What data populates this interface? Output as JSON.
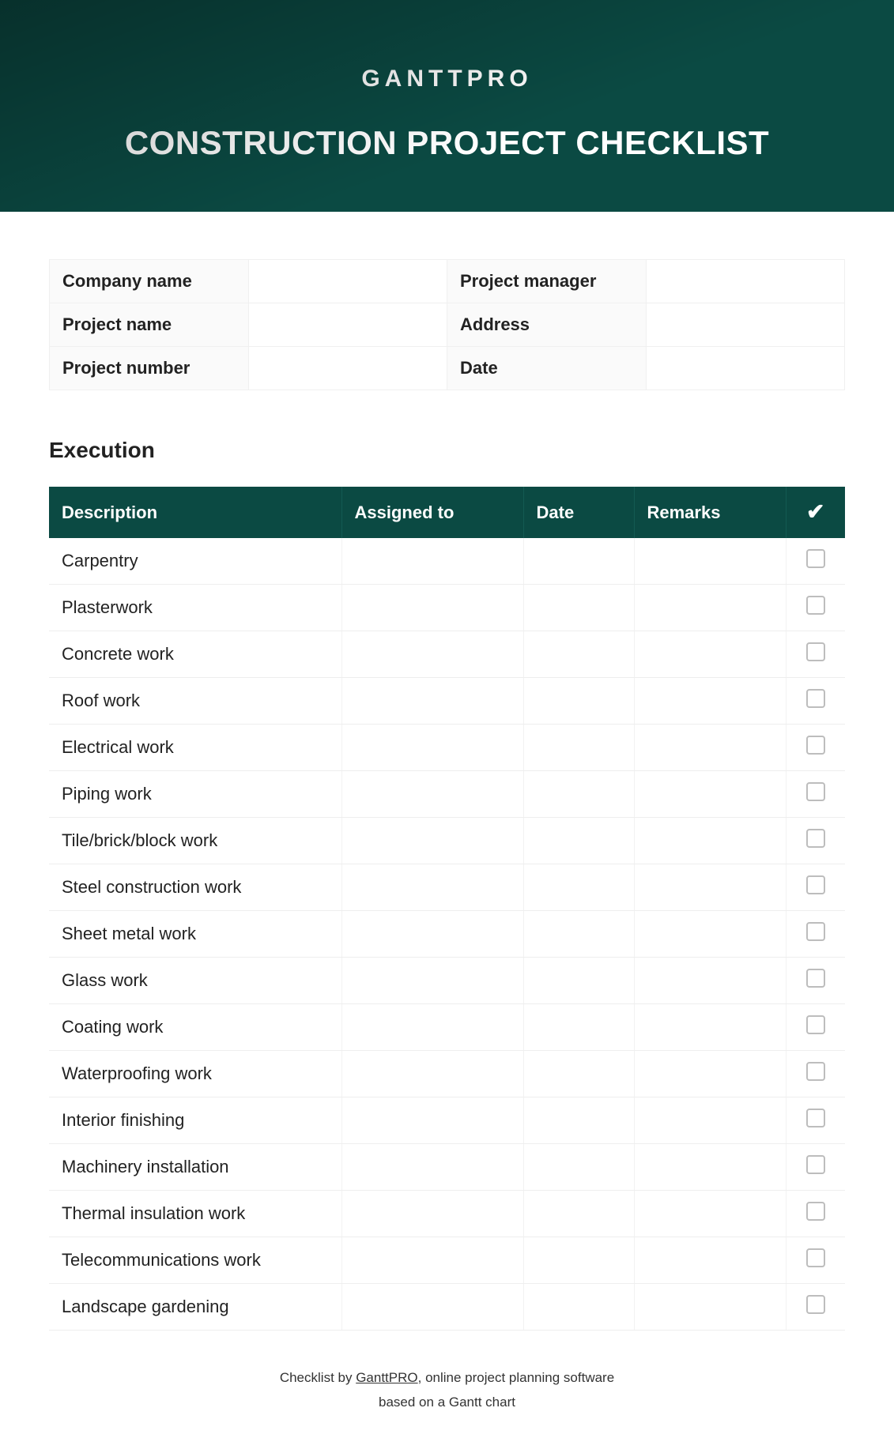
{
  "hero": {
    "logo": "GANTTPRO",
    "title": "CONSTRUCTION PROJECT CHECKLIST"
  },
  "info": {
    "rows": [
      {
        "left_label": "Company name",
        "left_value": "",
        "right_label": "Project manager",
        "right_value": ""
      },
      {
        "left_label": "Project name",
        "left_value": "",
        "right_label": "Address",
        "right_value": ""
      },
      {
        "left_label": "Project number",
        "left_value": "",
        "right_label": "Date",
        "right_value": ""
      }
    ]
  },
  "section": {
    "title": "Execution"
  },
  "checklist": {
    "headers": {
      "description": "Description",
      "assigned": "Assigned to",
      "date": "Date",
      "remarks": "Remarks",
      "check": "✔"
    },
    "rows": [
      {
        "description": "Carpentry",
        "assigned": "",
        "date": "",
        "remarks": "",
        "checked": false
      },
      {
        "description": "Plasterwork",
        "assigned": "",
        "date": "",
        "remarks": "",
        "checked": false
      },
      {
        "description": "Concrete work",
        "assigned": "",
        "date": "",
        "remarks": "",
        "checked": false
      },
      {
        "description": "Roof work",
        "assigned": "",
        "date": "",
        "remarks": "",
        "checked": false
      },
      {
        "description": "Electrical work",
        "assigned": "",
        "date": "",
        "remarks": "",
        "checked": false
      },
      {
        "description": "Piping work",
        "assigned": "",
        "date": "",
        "remarks": "",
        "checked": false
      },
      {
        "description": "Tile/brick/block work",
        "assigned": "",
        "date": "",
        "remarks": "",
        "checked": false
      },
      {
        "description": "Steel construction work",
        "assigned": "",
        "date": "",
        "remarks": "",
        "checked": false
      },
      {
        "description": "Sheet metal work",
        "assigned": "",
        "date": "",
        "remarks": "",
        "checked": false
      },
      {
        "description": "Glass work",
        "assigned": "",
        "date": "",
        "remarks": "",
        "checked": false
      },
      {
        "description": "Coating work",
        "assigned": "",
        "date": "",
        "remarks": "",
        "checked": false
      },
      {
        "description": "Waterproofing work",
        "assigned": "",
        "date": "",
        "remarks": "",
        "checked": false
      },
      {
        "description": "Interior finishing",
        "assigned": "",
        "date": "",
        "remarks": "",
        "checked": false
      },
      {
        "description": "Machinery installation",
        "assigned": "",
        "date": "",
        "remarks": "",
        "checked": false
      },
      {
        "description": "Thermal insulation work",
        "assigned": "",
        "date": "",
        "remarks": "",
        "checked": false
      },
      {
        "description": "Telecommunications work",
        "assigned": "",
        "date": "",
        "remarks": "",
        "checked": false
      },
      {
        "description": "Landscape gardening",
        "assigned": "",
        "date": "",
        "remarks": "",
        "checked": false
      }
    ]
  },
  "footer": {
    "line1_pre": "Checklist by ",
    "brand": "GanttPRO",
    "line1_post": ", online project planning software",
    "line2": "based on a Gantt chart"
  }
}
